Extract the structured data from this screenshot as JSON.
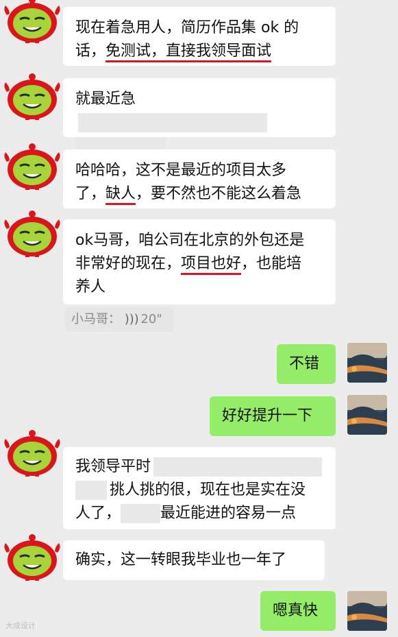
{
  "messages": {
    "m1": {
      "line1": "现在着急用人，简历作品集 ok 的",
      "line2_prefix": "话，",
      "line2_ul": "免测试，直接我领导面试"
    },
    "m2": {
      "text": "就最近急"
    },
    "m3": {
      "line1": "哈哈哈，这不是最近的项目太多",
      "line2_prefix": "了，",
      "line2_ul": "缺人",
      "line2_suffix": "，要不然也不能这么着急"
    },
    "m4": {
      "line1": "ok马哥，咱公司在北京的外包还是",
      "line2_prefix": "非常好的现在，",
      "line2_ul": "项目也好",
      "line2_suffix": "，也能培",
      "line3": "养人"
    },
    "voice": {
      "sender": "小马哥：",
      "icon": "sound-wave-icon",
      "duration": "20\""
    },
    "m5": {
      "text": "不错"
    },
    "m6": {
      "text": "好好提升一下"
    },
    "m7": {
      "line1": "我领导平时",
      "line2": "挑人挑的很，现在也是实在没",
      "line3_prefix": "人了，",
      "line3_suffix": "最近能进的容易一点"
    },
    "m8": {
      "text": "确实，这一转眼我毕业也一年了"
    },
    "m9": {
      "text": "嗯真快"
    }
  },
  "watermark": "大成设计",
  "colors": {
    "background": "#ececec",
    "green_bubble": "#95ec69",
    "underline": "#d8161b",
    "avatar_red": "#d8161b",
    "avatar_face": "#a7d43a"
  }
}
